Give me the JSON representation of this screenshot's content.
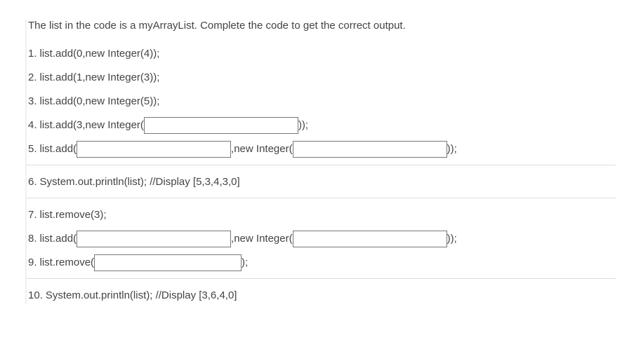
{
  "intro": "The list in the code is a myArrayList. Complete the code to get the correct output.",
  "lines": {
    "l1": "list.add(0,new Integer(4));",
    "l2": "list.add(1,new Integer(3));",
    "l3": "list.add(0,new Integer(5));",
    "l4_pre": "list.add(3,new Integer(",
    "l4_post": "));",
    "l5_pre": "list.add(",
    "l5_mid": ",new Integer(",
    "l5_post": "));",
    "l6": "System.out.println(list); //Display [5,3,4,3,0]",
    "l7": "list.remove(3);",
    "l8_pre": "list.add(",
    "l8_mid": ",new Integer(",
    "l8_post": "));",
    "l9_pre": "list.remove(",
    "l9_post": ");",
    "l10": "System.out.println(list); //Display [3,6,4,0]"
  },
  "blanks": {
    "b4": "",
    "b5a": "",
    "b5b": "",
    "b8a": "",
    "b8b": "",
    "b9": ""
  }
}
